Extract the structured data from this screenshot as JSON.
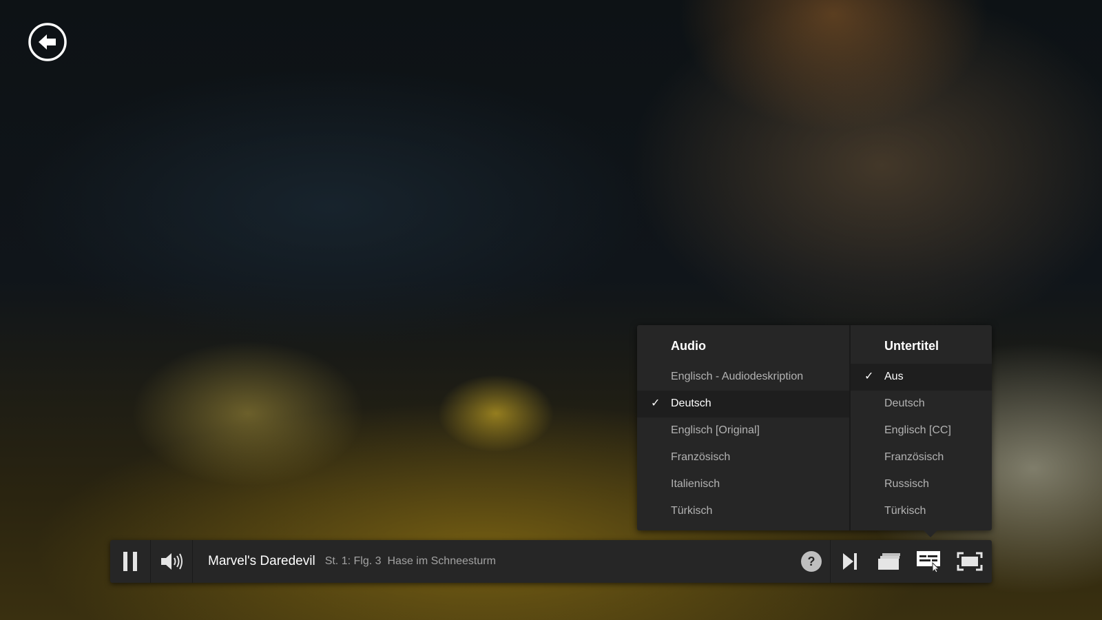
{
  "player": {
    "show_title": "Marvel's Daredevil",
    "episode_number": "St. 1: Flg. 3",
    "episode_title": "Hase im Schneesturm"
  },
  "audio_menu": {
    "heading": "Audio",
    "items": [
      {
        "label": "Englisch - Audiodeskription",
        "selected": false
      },
      {
        "label": "Deutsch",
        "selected": true
      },
      {
        "label": "Englisch [Original]",
        "selected": false
      },
      {
        "label": "Französisch",
        "selected": false
      },
      {
        "label": "Italienisch",
        "selected": false
      },
      {
        "label": "Türkisch",
        "selected": false
      }
    ]
  },
  "subtitle_menu": {
    "heading": "Untertitel",
    "items": [
      {
        "label": "Aus",
        "selected": true
      },
      {
        "label": "Deutsch",
        "selected": false
      },
      {
        "label": "Englisch [CC]",
        "selected": false
      },
      {
        "label": "Französisch",
        "selected": false
      },
      {
        "label": "Russisch",
        "selected": false
      },
      {
        "label": "Türkisch",
        "selected": false
      }
    ]
  },
  "check_glyph": "✓",
  "icons": {
    "back": "back-arrow-icon",
    "pause": "pause-icon",
    "volume": "volume-icon",
    "help": "help-icon",
    "next": "next-episode-icon",
    "episodes": "episodes-icon",
    "subtitles": "subtitles-icon",
    "fullscreen": "fullscreen-icon"
  },
  "colors": {
    "panel_bg": "#262626",
    "selected_bg": "#1e1e1e",
    "text_primary": "#ffffff",
    "text_secondary": "#b3b3b3"
  }
}
